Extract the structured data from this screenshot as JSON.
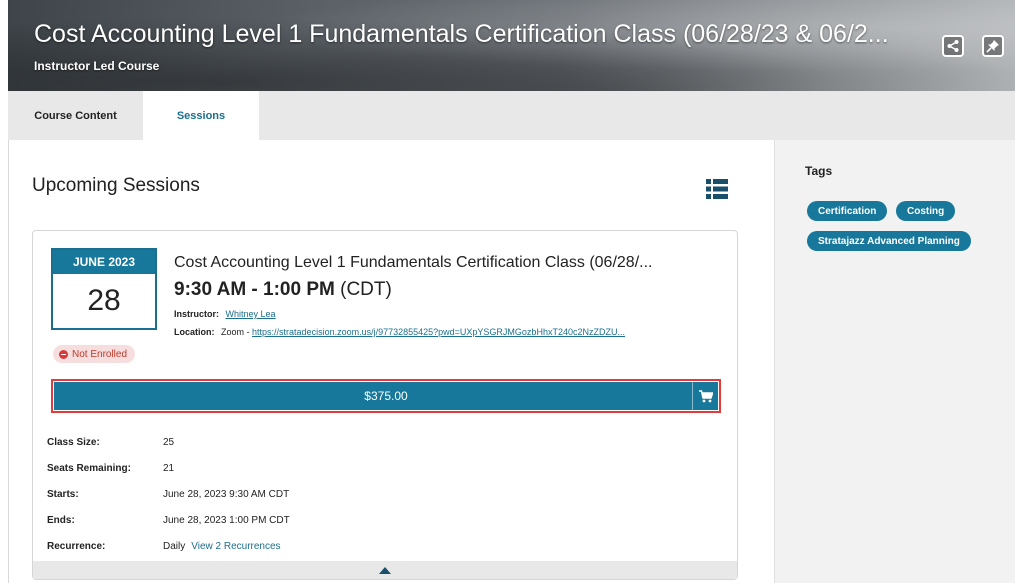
{
  "header": {
    "title": "Cost Accounting Level 1 Fundamentals Certification Class (06/28/23 & 06/2...",
    "subtitle": "Instructor Led Course",
    "share_icon": "share-icon",
    "pin_icon": "pin-icon"
  },
  "tabs": [
    {
      "label": "Course Content",
      "active": false
    },
    {
      "label": "Sessions",
      "active": true
    }
  ],
  "main": {
    "section_title": "Upcoming Sessions",
    "view_icon": "list-view-icon"
  },
  "session": {
    "month": "JUNE 2023",
    "day": "28",
    "enrollment_status": "Not Enrolled",
    "title": "Cost Accounting Level 1 Fundamentals Certification Class (06/28/...",
    "time_range": "9:30 AM - 1:00 PM",
    "timezone": "(CDT)",
    "instructor_label": "Instructor:",
    "instructor_name": "Whitney Lea",
    "location_label": "Location:",
    "location_prefix": "Zoom - ",
    "location_link": "https://stratadecision.zoom.us/j/97732855425?pwd=UXpYSGRJMGozbHhxT240c2NzZDZU...",
    "price": "$375.00",
    "details": [
      {
        "label": "Class Size:",
        "value": "25"
      },
      {
        "label": "Seats Remaining:",
        "value": "21"
      },
      {
        "label": "Starts:",
        "value": "June 28, 2023 9:30 AM CDT"
      },
      {
        "label": "Ends:",
        "value": "June 28, 2023 1:00 PM CDT"
      },
      {
        "label": "Recurrence:",
        "value": "Daily",
        "link": "View 2 Recurrences"
      }
    ]
  },
  "sidebar": {
    "tags_title": "Tags",
    "tags": [
      "Certification",
      "Costing",
      "Stratajazz Advanced Planning"
    ]
  },
  "colors": {
    "accent": "#17789b",
    "highlight_border": "#e23b3b",
    "not_enrolled": "#d63a3a"
  }
}
